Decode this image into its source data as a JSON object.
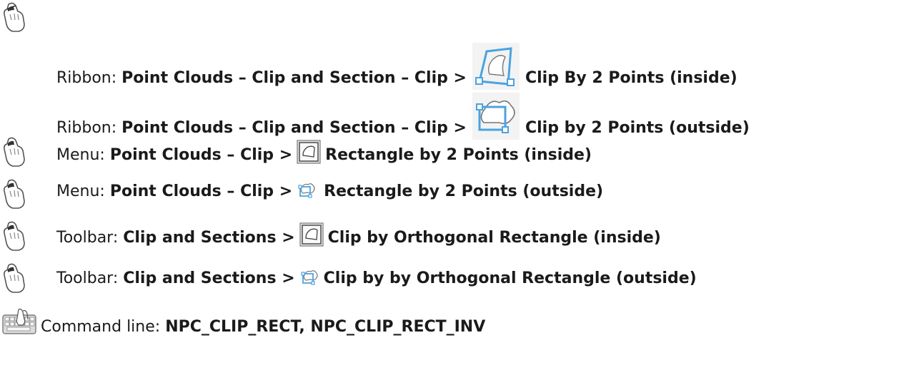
{
  "rows": [
    {
      "prefix": "Ribbon:",
      "path": "Point Clouds – Clip and Section – Clip >",
      "tool_icon": "clip-inside-large-icon",
      "label": "Clip By 2 Points (inside)",
      "access_icon": "mouse-icon"
    },
    {
      "prefix": "Ribbon:",
      "path": "Point Clouds – Clip and Section – Clip >",
      "tool_icon": "clip-outside-large-icon",
      "label": "Clip by 2 Points (outside)",
      "access_icon": ""
    },
    {
      "prefix": "Menu:",
      "path": "Point Clouds – Clip >",
      "tool_icon": "rect-inside-icon",
      "label": "Rectangle by 2 Points (inside)",
      "access_icon": "mouse-icon"
    },
    {
      "prefix": "Menu:",
      "path": "Point Clouds – Clip >",
      "tool_icon": "rect-outside-icon",
      "label": "Rectangle by 2 Points (outside)",
      "access_icon": "mouse-icon"
    },
    {
      "prefix": "Toolbar:",
      "path": "Clip and Sections >",
      "tool_icon": "rect-inside-icon",
      "label": "Clip by Orthogonal Rectangle (inside)",
      "access_icon": "mouse-icon"
    },
    {
      "prefix": "Toolbar:",
      "path": "Clip and Sections >",
      "tool_icon": "rect-outside-icon",
      "label": "Clip by by Orthogonal Rectangle (outside)",
      "access_icon": "mouse-icon"
    },
    {
      "prefix": "Command line:",
      "path": "NPC_CLIP_RECT, NPC_CLIP_RECT_INV",
      "tool_icon": "",
      "label": "",
      "access_icon": "keyboard-icon"
    }
  ]
}
